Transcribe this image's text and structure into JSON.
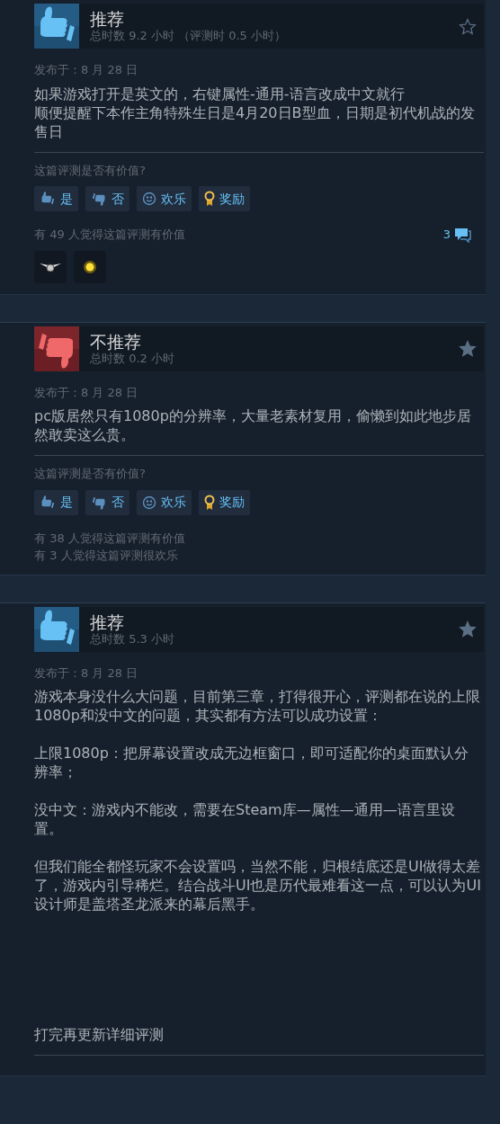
{
  "reviews": [
    {
      "kind": "recommended",
      "verdict": "推荐",
      "playtime": "总时数 9.2 小时",
      "review_time": "（评测时 0.5 小时）",
      "starred": false,
      "posted": "发布于：8 月 28 日",
      "paragraphs": [
        {
          "kind": "line",
          "text": "如果游戏打开是英文的，右键属性-通用-语言改成中文就行"
        },
        {
          "kind": "line",
          "text": "顺便提醒下本作主角特殊生日是4月20日B型血，日期是初代机战的发售日"
        }
      ],
      "helpful_prompt": "这篇评测是否有价值?",
      "buttons": [
        {
          "kind": "yes",
          "label": "是"
        },
        {
          "kind": "no",
          "label": "否"
        },
        {
          "kind": "funny",
          "label": "欢乐"
        },
        {
          "kind": "award",
          "label": "奖励"
        }
      ],
      "stats": [
        "有 49 人觉得这篇评测有价值"
      ],
      "comments": "3",
      "awards": [
        {
          "kind": "wings"
        },
        {
          "kind": "glow"
        }
      ]
    },
    {
      "kind": "not_recommended",
      "verdict": "不推荐",
      "playtime": "总时数 0.2 小时",
      "starred": true,
      "posted": "发布于：8 月 28 日",
      "paragraphs": [
        {
          "kind": "line",
          "text": "pc版居然只有1080p的分辨率，大量老素材复用，偷懒到如此地步居然敢卖这么贵。"
        }
      ],
      "helpful_prompt": "这篇评测是否有价值?",
      "buttons": [
        {
          "kind": "yes",
          "label": "是"
        },
        {
          "kind": "no",
          "label": "否"
        },
        {
          "kind": "funny",
          "label": "欢乐"
        },
        {
          "kind": "award",
          "label": "奖励"
        }
      ],
      "stats": [
        "有 38 人觉得这篇评测有价值",
        "有 3 人觉得这篇评测很欢乐"
      ]
    },
    {
      "kind": "recommended",
      "verdict": "推荐",
      "playtime": "总时数 5.3 小时",
      "starred": true,
      "posted": "发布于：8 月 28 日",
      "paragraphs": [
        {
          "kind": "para",
          "text": "游戏本身没什么大问题，目前第三章，打得很开心，评测都在说的上限1080p和没中文的问题，其实都有方法可以成功设置："
        },
        {
          "kind": "para",
          "text": "上限1080p：把屏幕设置改成无边框窗口，即可适配你的桌面默认分辨率；"
        },
        {
          "kind": "para",
          "text": "没中文：游戏内不能改，需要在Steam库—属性—通用—语言里设置。"
        },
        {
          "kind": "para",
          "text": "但我们能全都怪玩家不会设置吗，当然不能，归根结底还是UI做得太差了，游戏内引导稀烂。结合战斗UI也是历代最难看这一点，可以认为UI设计师是盖塔圣龙派来的幕后黑手。"
        },
        {
          "kind": "trailing",
          "text": "打完再更新详细评测"
        }
      ]
    }
  ]
}
